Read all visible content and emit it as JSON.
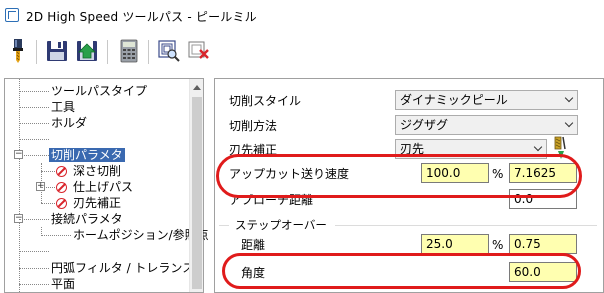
{
  "window": {
    "title": "2D High Speed ツールパス - ピールミル"
  },
  "toolbar": {
    "buttons": [
      {
        "name": "tool-icon"
      },
      {
        "name": "save-icon"
      },
      {
        "name": "save-calc-icon"
      },
      {
        "name": "calculator-icon"
      },
      {
        "name": "preview-icon"
      },
      {
        "name": "delete-icon"
      }
    ]
  },
  "tree": {
    "items": [
      {
        "label": "ツールパスタイプ"
      },
      {
        "label": "工具"
      },
      {
        "label": "ホルダ"
      },
      {
        "label": ""
      },
      {
        "label": "切削パラメタ",
        "selected": true
      },
      {
        "label": "深さ切削"
      },
      {
        "label": "仕上げパス"
      },
      {
        "label": "刃先補正"
      },
      {
        "label": "接続パラメタ"
      },
      {
        "label": "ホームポジション/参照点"
      },
      {
        "label": ""
      },
      {
        "label": "円弧フィルタ / トレランス"
      },
      {
        "label": "平面"
      }
    ]
  },
  "params": {
    "cut_style_label": "切削スタイル",
    "cut_style_value": "ダイナミックピール",
    "cut_method_label": "切削方法",
    "cut_method_value": "ジグザグ",
    "comp_label": "刃先補正",
    "comp_value": "刃先",
    "upcut_label": "アップカット送り速度",
    "upcut_value": "100.0",
    "upcut_unit": "%",
    "upcut_value2": "7.1625",
    "approach_label": "アプローチ距離",
    "approach_value": "0.0",
    "stepover_group": "ステップオーバー",
    "distance_label": "距離",
    "distance_value": "25.0",
    "distance_unit": "%",
    "distance_value2": "0.75",
    "angle_label": "角度",
    "angle_value": "60.0"
  },
  "colors": {
    "highlight": "#e01b1b",
    "input_bg": "#ffffb0",
    "selection": "#3a69b0"
  }
}
